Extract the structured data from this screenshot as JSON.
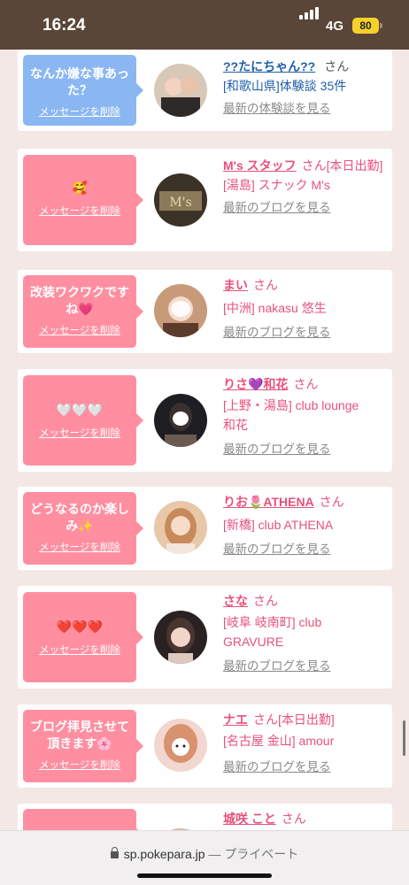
{
  "status_bar": {
    "time": "16:24",
    "network": "4G",
    "battery": "80"
  },
  "feed": {
    "items": [
      {
        "message": "なんか嫌な事あった？",
        "delete_label": "メッセージを削除",
        "name": "??たにちゃん??",
        "suffix": "さん",
        "line2": "[和歌山県]体験談 35件",
        "line3": "",
        "link": "最新の体験談を見る"
      },
      {
        "message": "🥰",
        "delete_label": "メッセージを削除",
        "name": "M's スタッフ",
        "suffix": "さん[本日出勤]",
        "line2": "[湯島] スナック M's",
        "line3": "",
        "link": "最新のブログを見る"
      },
      {
        "message": "改装ワクワクですね💗",
        "delete_label": "メッセージを削除",
        "name": "まい",
        "suffix": "さん",
        "line2": "[中洲] nakasu 悠生",
        "line3": "",
        "link": "最新のブログを見る"
      },
      {
        "message": "🤍🤍🤍",
        "delete_label": "メッセージを削除",
        "name": "りさ💜和花",
        "suffix": "さん",
        "line2": "[上野・湯島] club lounge",
        "line3": "和花",
        "link": "最新のブログを見る"
      },
      {
        "message": "どうなるのか楽しみ✨",
        "delete_label": "メッセージを削除",
        "name": "りお🌷ATHENA",
        "suffix": "さん",
        "line2": "[新橋] club ATHENA",
        "line3": "",
        "link": "最新のブログを見る"
      },
      {
        "message": "❤️❤️❤️",
        "delete_label": "メッセージを削除",
        "name": "さな",
        "suffix": "さん",
        "line2": "[岐阜 岐南町] club",
        "line3": "GRAVURE",
        "link": "最新のブログを見る"
      },
      {
        "message": "ブログ拝見させて頂きます🌸",
        "delete_label": "メッセージを削除",
        "name": "ナエ",
        "suffix": "さん[本日出勤]",
        "line2": "[名古屋 金山] amour",
        "line3": "",
        "link": "最新のブログを見る"
      },
      {
        "message": "",
        "delete_label": "",
        "name": "城咲 こと",
        "suffix": "さん",
        "line2": "",
        "line3": "",
        "link": ""
      }
    ]
  },
  "address_bar": {
    "url": "sp.pokepara.jp",
    "separator": " — ",
    "mode": "プライベート"
  },
  "colors": {
    "accent_pink": "#e8517a",
    "bubble_pink": "#ff8fa0",
    "bubble_blue": "#8ab7f2",
    "link_blue": "#1f5fa9",
    "status_bar_bg": "#5a4638"
  }
}
